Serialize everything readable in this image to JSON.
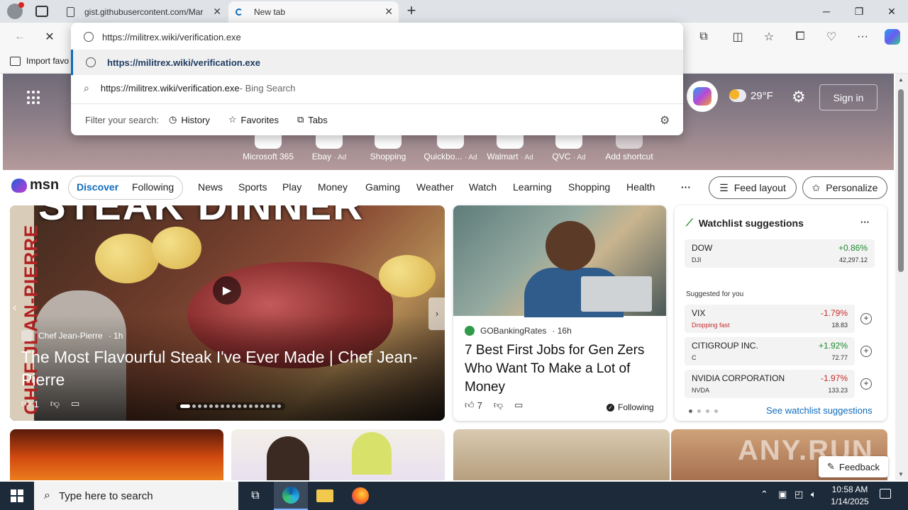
{
  "tabs": [
    {
      "title": "gist.githubusercontent.com/Mar"
    },
    {
      "title": "New tab"
    }
  ],
  "address": {
    "value": "https://militrex.wiki/verification.exe"
  },
  "omnibox": {
    "suggestion_url": "https://militrex.wiki/verification.exe",
    "search_query": "https://militrex.wiki/verification.exe",
    "search_suffix": " - Bing Search",
    "filter_label": "Filter your search:",
    "filters": [
      "History",
      "Favorites",
      "Tabs"
    ]
  },
  "favbar": {
    "import_label": "Import favo"
  },
  "weather": {
    "temp": "29°F"
  },
  "hero": {
    "signin": "Sign in"
  },
  "shortcuts": [
    {
      "label": "Microsoft 365",
      "ad": ""
    },
    {
      "label": "Ebay",
      "ad": "· Ad"
    },
    {
      "label": "Shopping",
      "ad": ""
    },
    {
      "label": "Quickbo...",
      "ad": "· Ad"
    },
    {
      "label": "Walmart",
      "ad": "· Ad"
    },
    {
      "label": "QVC",
      "ad": "· Ad"
    },
    {
      "label": "Add shortcut",
      "ad": ""
    }
  ],
  "nav": {
    "logo": "msn",
    "discover": "Discover",
    "following": "Following",
    "items": [
      "News",
      "Sports",
      "Play",
      "Money",
      "Gaming",
      "Weather",
      "Watch",
      "Learning",
      "Shopping",
      "Health"
    ],
    "more": "···",
    "feed_layout": "Feed layout",
    "personalize": "Personalize"
  },
  "featured": {
    "banner": "STEAK DINNER",
    "side_text": "CHEF JEAN-PIERRE",
    "source": "Chef Jean-Pierre",
    "age": "· 1h",
    "title": "The Most Flavourful Steak I've Ever Made | Chef Jean-Pierre",
    "likes": "1"
  },
  "card2": {
    "source": "GOBankingRates",
    "age": "· 16h",
    "title": "7 Best First Jobs for Gen Zers Who Want To Make a Lot of Money",
    "likes": "7",
    "following": "Following"
  },
  "watchlist": {
    "title": "Watchlist suggestions",
    "more": "···",
    "suggested_label": "Suggested for you",
    "see_more": "See watchlist suggestions",
    "items": [
      {
        "name": "DOW",
        "symbol": "DJI",
        "change": "+0.86%",
        "price": "42,297.12"
      },
      {
        "name": "VIX",
        "symbol": "Dropping fast",
        "change": "-1.79%",
        "price": "18.83"
      },
      {
        "name": "CITIGROUP INC.",
        "symbol": "C",
        "change": "+1.92%",
        "price": "72.77"
      },
      {
        "name": "NVIDIA CORPORATION",
        "symbol": "NVDA",
        "change": "-1.97%",
        "price": "133.23"
      }
    ]
  },
  "feedback": "Feedback",
  "watermark": "ANY.RUN",
  "taskbar": {
    "search_placeholder": "Type here to search",
    "time": "10:58 AM",
    "date": "1/14/2025"
  },
  "colors": {
    "accent": "#0f6cbd",
    "positive": "#1d8a2e",
    "negative": "#c62b2b",
    "taskbar": "#1c2a3a"
  }
}
